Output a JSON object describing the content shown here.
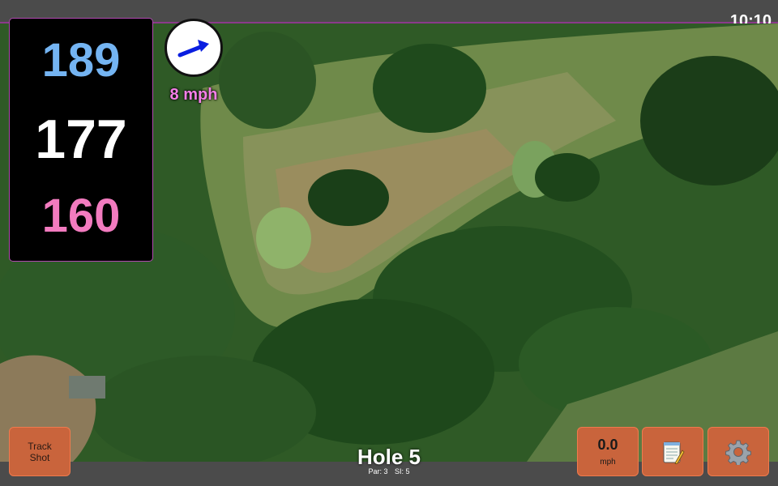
{
  "status_bar": {
    "time": "10:10"
  },
  "distances": {
    "back": "189",
    "middle": "177",
    "front": "160",
    "colors": {
      "back": "#74b4f2",
      "middle": "#ffffff",
      "front": "#f27bbf"
    }
  },
  "wind": {
    "speed": "8 mph",
    "arrow_color": "#0a1ee0",
    "speed_color": "#f47fe8"
  },
  "buttons": {
    "track_shot_line1": "Track",
    "track_shot_line2": "Shot",
    "speed_value": "0.0",
    "speed_unit": "mph",
    "notes_icon": "notepad-icon",
    "settings_icon": "gear-icon",
    "accent": "#c9643c"
  },
  "hole": {
    "title": "Hole 5",
    "par_label": "Par: 3",
    "si_label": "SI: 5"
  }
}
